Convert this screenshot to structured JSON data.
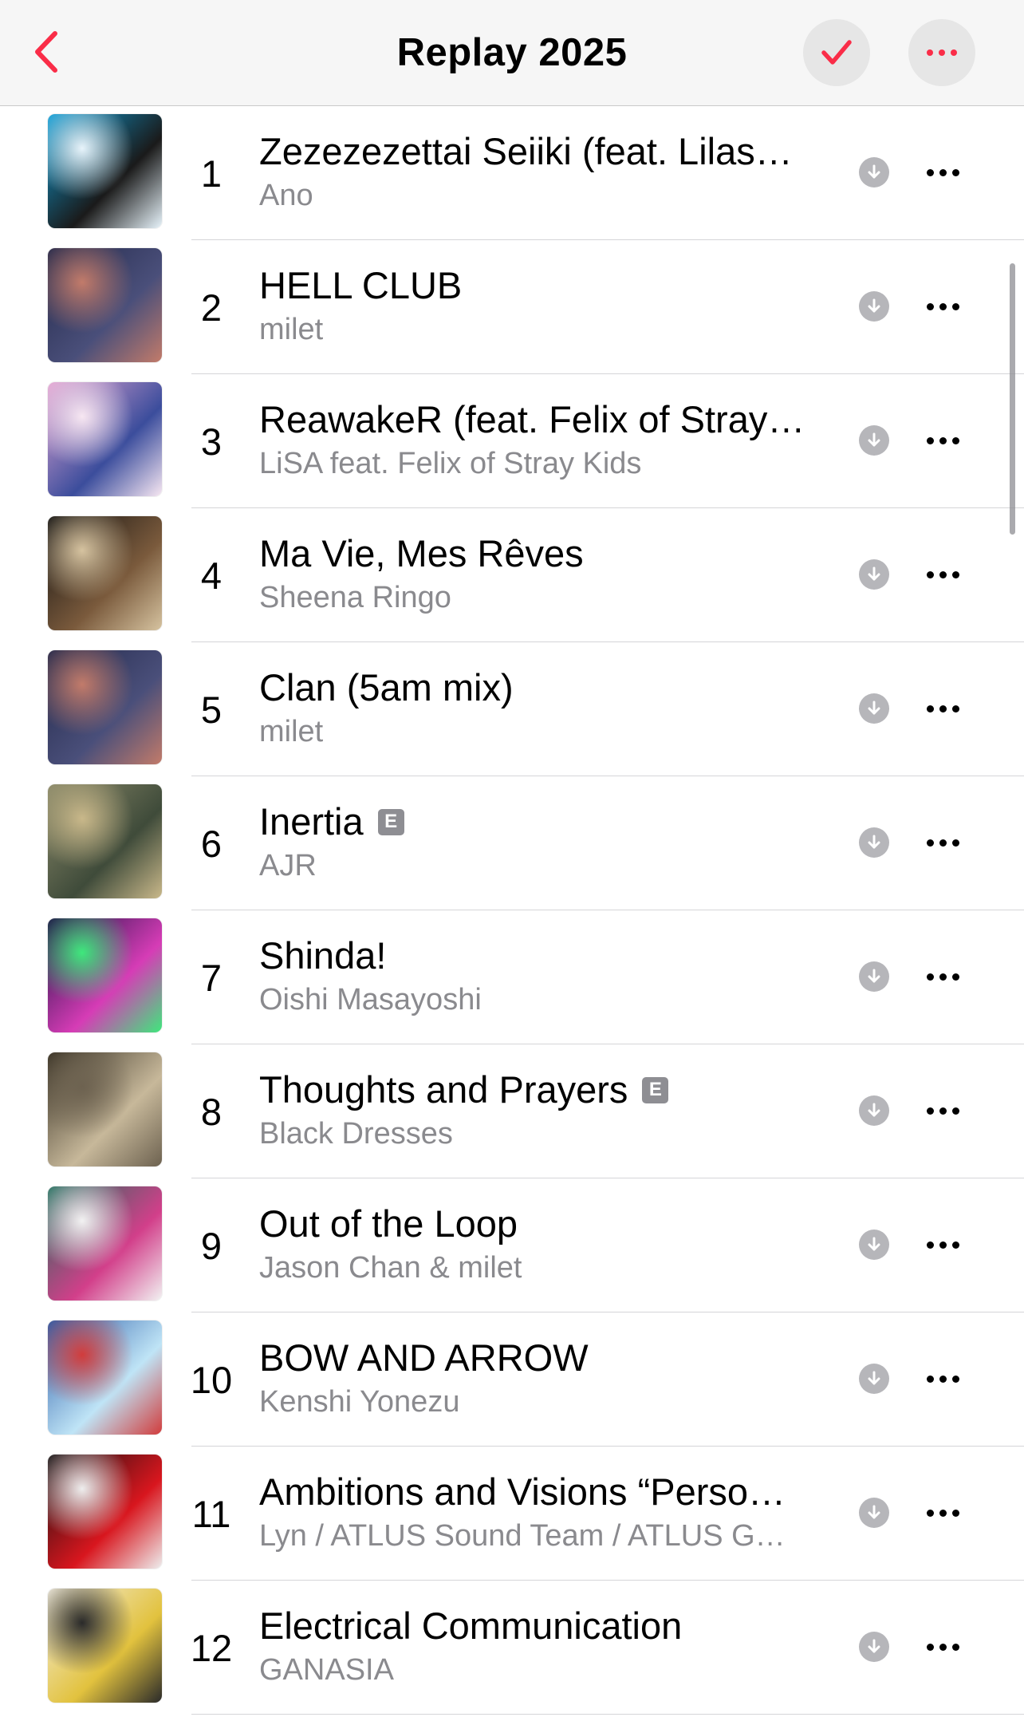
{
  "header": {
    "title": "Replay 2025",
    "back_icon": "chevron-left-icon",
    "done_icon": "checkmark-icon",
    "more_icon": "ellipsis-icon",
    "accent_color": "#fa2d48"
  },
  "tracks": [
    {
      "rank": "1",
      "title": "Zezezezettai Seiiki (feat. Lilas…",
      "artist": "Ano",
      "explicit": false,
      "art_colors": [
        "#0f9fd8",
        "#1a1a1a",
        "#e8f4fb"
      ]
    },
    {
      "rank": "2",
      "title": "HELL CLUB",
      "artist": "milet",
      "explicit": false,
      "art_colors": [
        "#23294a",
        "#4a4f7a",
        "#c27b6a"
      ]
    },
    {
      "rank": "3",
      "title": "ReawakeR (feat. Felix of Stray…",
      "artist": "LiSA feat. Felix of Stray Kids",
      "explicit": false,
      "art_colors": [
        "#e6a8d4",
        "#3b4d9c",
        "#f7e7f2"
      ]
    },
    {
      "rank": "4",
      "title": "Ma Vie, Mes Rêves",
      "artist": "Sheena Ringo",
      "explicit": false,
      "art_colors": [
        "#111111",
        "#7a5a3c",
        "#d6c3a0"
      ]
    },
    {
      "rank": "5",
      "title": "Clan (5am mix)",
      "artist": "milet",
      "explicit": false,
      "art_colors": [
        "#23294a",
        "#4a4f7a",
        "#c27b6a"
      ]
    },
    {
      "rank": "6",
      "title": "Inertia",
      "artist": "AJR",
      "explicit": true,
      "art_colors": [
        "#8b8a6a",
        "#3f4b3a",
        "#c9b88a"
      ]
    },
    {
      "rank": "7",
      "title": "Shinda!",
      "artist": "Oishi Masayoshi",
      "explicit": false,
      "art_colors": [
        "#1a1244",
        "#d63cb6",
        "#3ee87c"
      ]
    },
    {
      "rank": "8",
      "title": "Thoughts and Prayers",
      "artist": "Black Dresses",
      "explicit": true,
      "art_colors": [
        "#3a3326",
        "#c7b89a",
        "#6d6250"
      ]
    },
    {
      "rank": "9",
      "title": "Out of the Loop",
      "artist": "Jason Chan & milet",
      "explicit": false,
      "art_colors": [
        "#1f6e5c",
        "#d23f8a",
        "#f2f2f2"
      ]
    },
    {
      "rank": "10",
      "title": "BOW AND ARROW",
      "artist": "Kenshi Yonezu",
      "explicit": false,
      "art_colors": [
        "#2b5ca8",
        "#bfe4f6",
        "#d13c3c"
      ]
    },
    {
      "rank": "11",
      "title": "Ambitions and Visions “Perso…",
      "artist": "Lyn / ATLUS Sound Team / ATLUS G…",
      "explicit": false,
      "art_colors": [
        "#111111",
        "#d8161e",
        "#eeeeee"
      ]
    },
    {
      "rank": "12",
      "title": "Electrical Communication",
      "artist": "GANASIA",
      "explicit": false,
      "art_colors": [
        "#f4efe2",
        "#e2c23e",
        "#2a2a2a"
      ]
    }
  ],
  "explicit_badge": "E",
  "row_icons": {
    "download": "download-arrow-icon",
    "more": "ellipsis-icon"
  }
}
